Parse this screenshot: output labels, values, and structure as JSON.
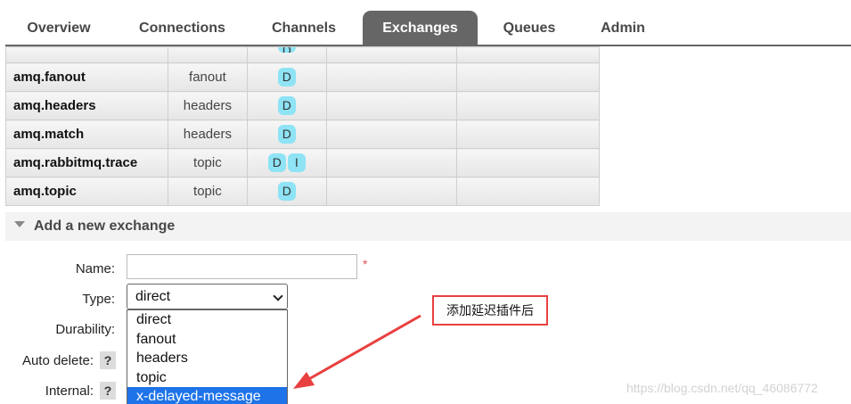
{
  "tabs": [
    {
      "label": "Overview",
      "active": false
    },
    {
      "label": "Connections",
      "active": false
    },
    {
      "label": "Channels",
      "active": false
    },
    {
      "label": "Exchanges",
      "active": true
    },
    {
      "label": "Queues",
      "active": false
    },
    {
      "label": "Admin",
      "active": false
    }
  ],
  "exchanges": {
    "partial_row_feature": "D",
    "rows": [
      {
        "name": "amq.fanout",
        "type": "fanout",
        "features": [
          "D"
        ]
      },
      {
        "name": "amq.headers",
        "type": "headers",
        "features": [
          "D"
        ]
      },
      {
        "name": "amq.match",
        "type": "headers",
        "features": [
          "D"
        ]
      },
      {
        "name": "amq.rabbitmq.trace",
        "type": "topic",
        "features": [
          "D",
          "I"
        ]
      },
      {
        "name": "amq.topic",
        "type": "topic",
        "features": [
          "D"
        ]
      }
    ]
  },
  "add_exchange": {
    "title": "Add a new exchange",
    "name_label": "Name:",
    "name_value": "",
    "required_mark": "*",
    "type_label": "Type:",
    "type_selected": "direct",
    "type_options": [
      "direct",
      "fanout",
      "headers",
      "topic",
      "x-delayed-message"
    ],
    "type_highlighted": "x-delayed-message",
    "durability_label": "Durability:",
    "auto_delete_label": "Auto delete:",
    "internal_label": "Internal:",
    "help_mark": "?"
  },
  "annotation": {
    "text": "添加延迟插件后",
    "border_color": "#e84040"
  },
  "watermark": "https://blog.csdn.net/qq_46086772",
  "colors": {
    "active_tab": "#666666",
    "badge": "#8ee3f5",
    "selected_option": "#1e73e8"
  }
}
